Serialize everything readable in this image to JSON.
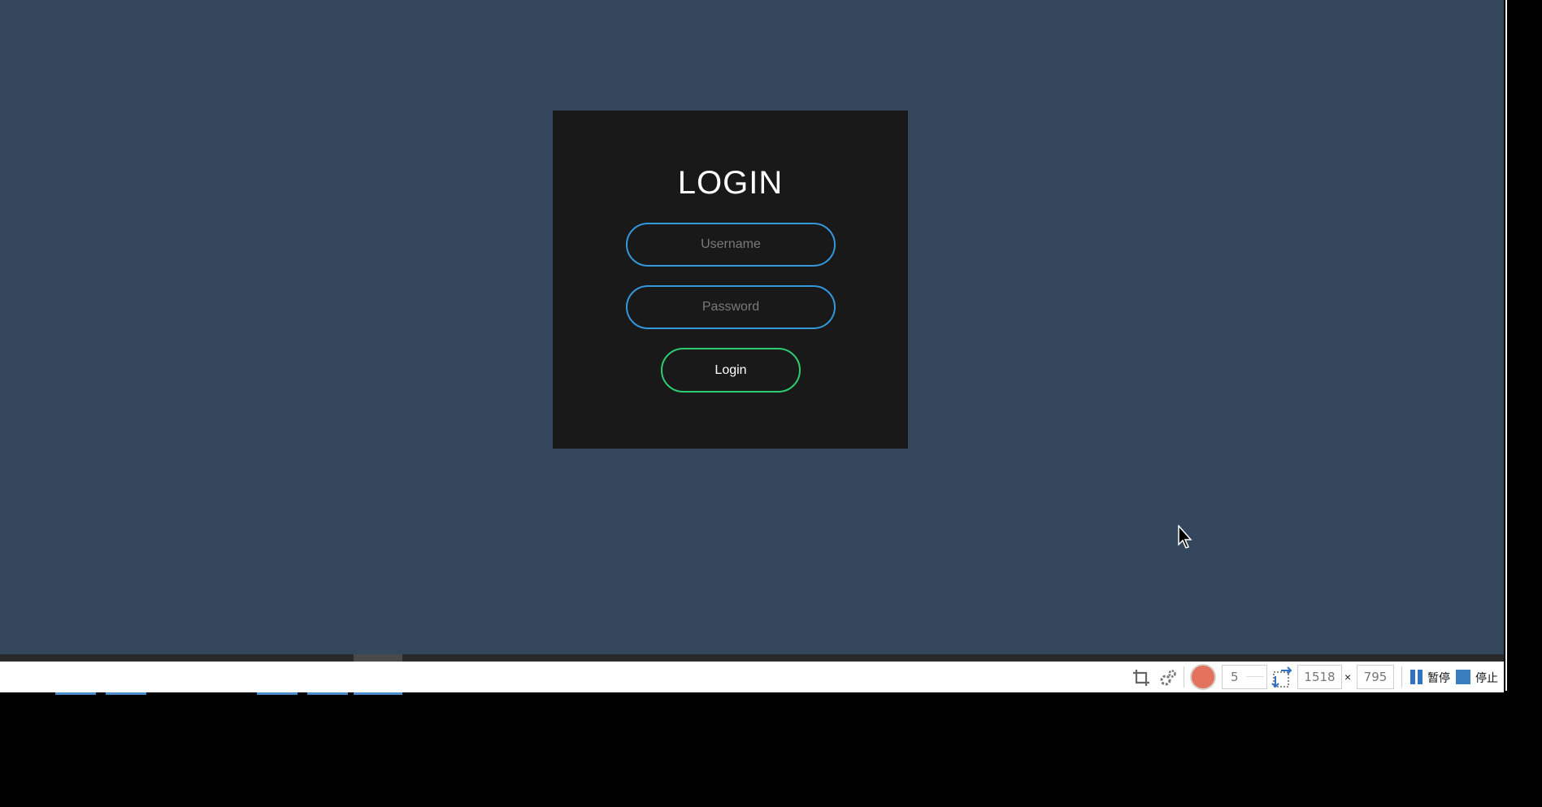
{
  "login": {
    "title": "LOGIN",
    "username_placeholder": "Username",
    "password_placeholder": "Password",
    "button_label": "Login"
  },
  "recorder": {
    "fps_value": "5",
    "width_value": "1518",
    "times": "×",
    "height_value": "795",
    "pause_label": "暂停",
    "stop_label": "停止"
  },
  "colors": {
    "background": "#34475d",
    "card": "#191919",
    "input_border": "#3498db",
    "button_border": "#2ecc71",
    "record": "#e3735c",
    "stop": "#3a7ebf"
  },
  "icons": [
    "crop-icon",
    "gear-icon",
    "record-icon",
    "resize-icon",
    "pause-icon",
    "stop-icon",
    "mouse-cursor"
  ]
}
